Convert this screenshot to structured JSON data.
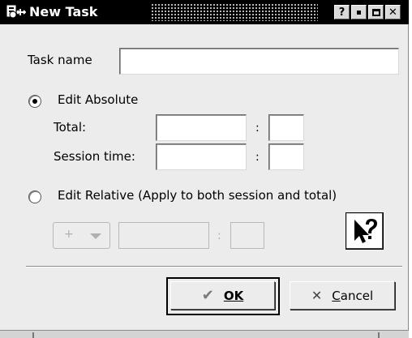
{
  "window": {
    "title": "New Task",
    "buttons": {
      "help": "?",
      "close": "✕"
    }
  },
  "form": {
    "task_name": {
      "label": "Task name",
      "value": ""
    },
    "absolute": {
      "label": "Edit Absolute",
      "selected": true,
      "total_label": "Total:",
      "session_label": "Session time:",
      "separator": ":",
      "total_hours": "",
      "total_minutes": "",
      "session_hours": "",
      "session_minutes": ""
    },
    "relative": {
      "label": "Edit Relative (Apply to both session and total)",
      "selected": false,
      "sign_value": "+",
      "separator": ":",
      "hours": "",
      "minutes": ""
    }
  },
  "footer": {
    "ok_label": "OK",
    "cancel_label": "Cancel"
  },
  "icons": {
    "app": "task-app-icon",
    "help": "whats-this-icon",
    "ok": "checkmark-icon",
    "cancel": "x-icon"
  }
}
